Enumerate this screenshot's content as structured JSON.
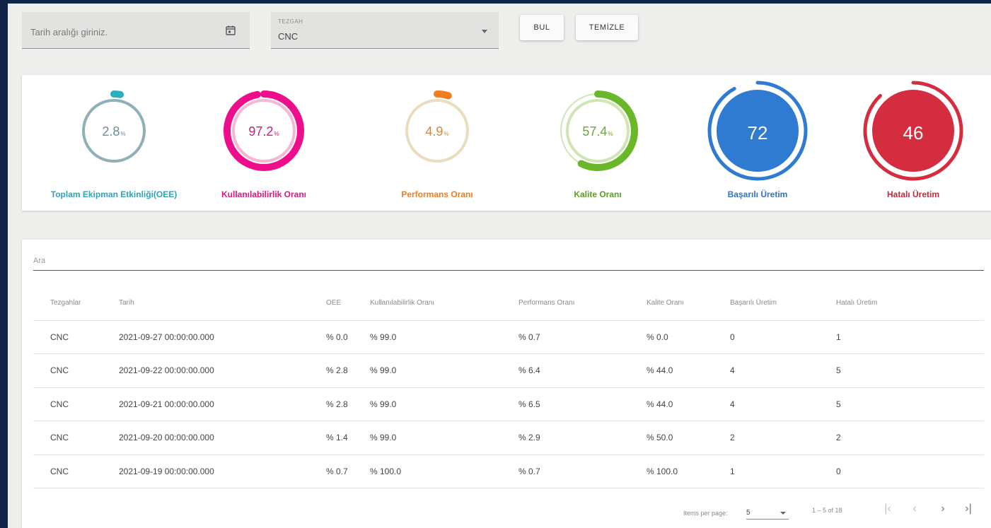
{
  "filters": {
    "date_placeholder": "Tarih aralığı giriniz.",
    "machine_label": "TEZGAH",
    "machine_value": "CNC",
    "find_label": "BUL",
    "clear_label": "TEMİZLE"
  },
  "metrics": [
    {
      "key": "oee",
      "label": "Toplam Ekipman Etkinliği(OEE)",
      "value": "2.8",
      "unit": "%",
      "fraction": 0.028,
      "color": "#8fb0b8",
      "track": "#8fb0b8",
      "label_color": "#2aa5b8",
      "arc": "#2aafbd",
      "style": "ring"
    },
    {
      "key": "availability",
      "label": "Kullanılabilirlik Oranı",
      "value": "97.2",
      "unit": "%",
      "fraction": 0.972,
      "color": "#ee0e8c",
      "track": "#f5b7d6",
      "label_color": "#e0137f",
      "arc": "#ee0e8c",
      "style": "ring"
    },
    {
      "key": "performance",
      "label": "Performans Oranı",
      "value": "4.9",
      "unit": "%",
      "fraction": 0.049,
      "color": "#e8d8b8",
      "track": "#ebdcbe",
      "label_color": "#ef7d1a",
      "arc": "#f07c1c",
      "style": "ring"
    },
    {
      "key": "quality",
      "label": "Kalite Oranı",
      "value": "57.4",
      "unit": "%",
      "fraction": 0.574,
      "color": "#6fb52c",
      "track": "#cfe6b4",
      "label_color": "#58a21e",
      "arc": "#6ab82a",
      "style": "ring"
    },
    {
      "key": "successful",
      "label": "Başarılı Üretim",
      "value": "72",
      "fraction": 0.92,
      "color": "#2f7bd2",
      "label_color": "#2f74c9",
      "arc": "#2f7bd2",
      "style": "filled"
    },
    {
      "key": "faulty",
      "label": "Hatalı Üretim",
      "value": "46",
      "fraction": 0.88,
      "color": "#d42d3f",
      "label_color": "#c8283a",
      "arc": "#d42d3f",
      "style": "filled"
    }
  ],
  "table": {
    "search_placeholder": "Ara",
    "headers": [
      "Tezgahlar",
      "Tarih",
      "OEE",
      "Kullanılabilirlik Oranı",
      "Performans Oranı",
      "Kalite Oranı",
      "Başarılı Üretim",
      "Hatalı Üretim"
    ],
    "rows": [
      [
        "CNC",
        "2021-09-27 00:00:00.000",
        "% 0.0",
        "% 99.0",
        "% 0.7",
        "% 0.0",
        "0",
        "1"
      ],
      [
        "CNC",
        "2021-09-22 00:00:00.000",
        "% 2.8",
        "% 99.0",
        "% 6.4",
        "% 44.0",
        "4",
        "5"
      ],
      [
        "CNC",
        "2021-09-21 00:00:00.000",
        "% 2.8",
        "% 99.0",
        "% 6.5",
        "% 44.0",
        "4",
        "5"
      ],
      [
        "CNC",
        "2021-09-20 00:00:00.000",
        "% 1.4",
        "% 99.0",
        "% 2.9",
        "% 50.0",
        "2",
        "2"
      ],
      [
        "CNC",
        "2021-09-19 00:00:00.000",
        "% 0.7",
        "% 100.0",
        "% 0.7",
        "% 100.0",
        "1",
        "0"
      ]
    ]
  },
  "paginator": {
    "items_per_page_label": "Items per page:",
    "page_size": "5",
    "range_label": "1 – 5 of 18",
    "first_icon": "first-page-icon",
    "prev_icon": "chevron-left-icon",
    "next_icon": "chevron-right-icon",
    "last_icon": "last-page-icon"
  }
}
